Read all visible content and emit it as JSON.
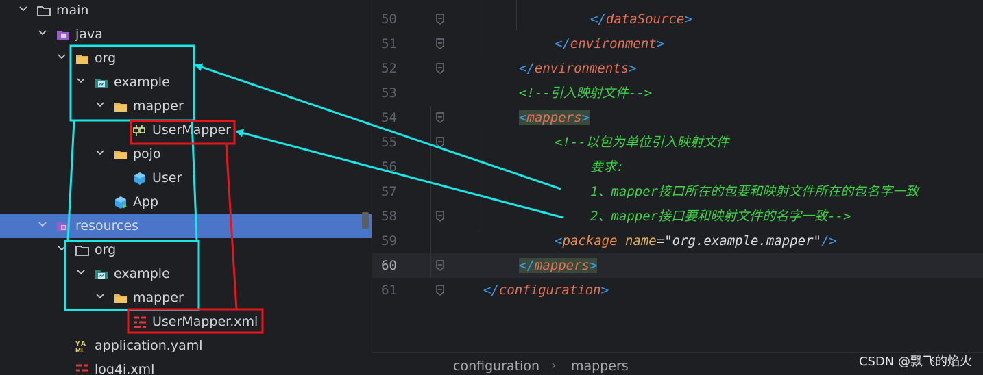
{
  "tree": [
    {
      "label": "main",
      "icon": "folder-icon",
      "chev": "down",
      "indent": 0
    },
    {
      "label": "java",
      "icon": "java-source-folder-icon",
      "chev": "down",
      "indent": 1
    },
    {
      "label": "org",
      "icon": "package-folder-icon",
      "chev": "down",
      "indent": 2
    },
    {
      "label": "example",
      "icon": "package-icon",
      "chev": "down",
      "indent": 3
    },
    {
      "label": "mapper",
      "icon": "package-folder-icon",
      "chev": "down",
      "indent": 4
    },
    {
      "label": "UserMapper",
      "icon": "interface-icon",
      "chev": "none",
      "indent": 5
    },
    {
      "label": "pojo",
      "icon": "package-folder-icon",
      "chev": "down",
      "indent": 4
    },
    {
      "label": "User",
      "icon": "class-icon",
      "chev": "none",
      "indent": 5
    },
    {
      "label": "App",
      "icon": "app-class-icon",
      "chev": "none",
      "indent": 4
    },
    {
      "label": "resources",
      "icon": "resources-folder-icon",
      "chev": "down",
      "indent": 1,
      "selected": true
    },
    {
      "label": "org",
      "icon": "folder-icon",
      "chev": "down",
      "indent": 2
    },
    {
      "label": "example",
      "icon": "package-icon",
      "chev": "down",
      "indent": 3
    },
    {
      "label": "mapper",
      "icon": "package-folder-icon",
      "chev": "down",
      "indent": 4
    },
    {
      "label": "UserMapper.xml",
      "icon": "xml-file-icon",
      "chev": "none",
      "indent": 5
    },
    {
      "label": "application.yaml",
      "icon": "yaml-file-icon",
      "chev": "none",
      "indent": 2
    },
    {
      "label": "log4j.xml",
      "icon": "xml-file-icon",
      "chev": "none",
      "indent": 2
    }
  ],
  "editor": {
    "current_line": "60",
    "lines": [
      {
        "num": "50",
        "tokens": [
          {
            "t": "</",
            "c": "br"
          },
          {
            "t": "dataSource",
            "c": "tag"
          },
          {
            "t": ">",
            "c": "br"
          }
        ],
        "indent": 4
      },
      {
        "num": "51",
        "tokens": [
          {
            "t": "</",
            "c": "br"
          },
          {
            "t": "environment",
            "c": "tag"
          },
          {
            "t": ">",
            "c": "br"
          }
        ],
        "indent": 3
      },
      {
        "num": "52",
        "tokens": [
          {
            "t": "</",
            "c": "br"
          },
          {
            "t": "environments",
            "c": "tag"
          },
          {
            "t": ">",
            "c": "br"
          }
        ],
        "indent": 2
      },
      {
        "num": "53",
        "tokens": [
          {
            "t": "<!--引入映射文件-->",
            "c": "cm"
          }
        ],
        "indent": 2
      },
      {
        "num": "54",
        "tokens": [
          {
            "t": "<",
            "c": "br",
            "hl": true
          },
          {
            "t": "mappers",
            "c": "tag",
            "hl": true
          },
          {
            "t": ">",
            "c": "br",
            "hl": true
          }
        ],
        "indent": 2
      },
      {
        "num": "55",
        "tokens": [
          {
            "t": "<!--以包为单位引入映射文件",
            "c": "cm"
          }
        ],
        "indent": 3
      },
      {
        "num": "56",
        "tokens": [
          {
            "t": "要求:",
            "c": "cm"
          }
        ],
        "indent": 4
      },
      {
        "num": "57",
        "tokens": [
          {
            "t": "1、mapper接口所在的包要和映射文件所在的包名字一致",
            "c": "cm"
          }
        ],
        "indent": 4
      },
      {
        "num": "58",
        "tokens": [
          {
            "t": "2、mapper接口要和映射文件的名字一致-->",
            "c": "cm"
          }
        ],
        "indent": 4
      },
      {
        "num": "59",
        "tokens": [
          {
            "t": "<",
            "c": "br"
          },
          {
            "t": "package",
            "c": "tag2"
          },
          {
            "t": " ",
            "c": "val"
          },
          {
            "t": "name",
            "c": "attr"
          },
          {
            "t": "=",
            "c": "val"
          },
          {
            "t": "\"org.example.mapper\"",
            "c": "val"
          },
          {
            "t": "/>",
            "c": "br"
          }
        ],
        "indent": 3
      },
      {
        "num": "60",
        "tokens": [
          {
            "t": "</",
            "c": "br",
            "hl": true
          },
          {
            "t": "mappers",
            "c": "tag",
            "hl": true
          },
          {
            "t": ">",
            "c": "br",
            "hl": true
          }
        ],
        "indent": 2
      },
      {
        "num": "61",
        "tokens": [
          {
            "t": "</",
            "c": "br"
          },
          {
            "t": "configuration",
            "c": "tag"
          },
          {
            "t": ">",
            "c": "br"
          }
        ],
        "indent": 1
      }
    ]
  },
  "breadcrumb": {
    "item1": "configuration",
    "item2": "mappers"
  },
  "watermark": "CSDN @飘飞的焰火",
  "colors": {
    "cyan_box": "#19e6e6",
    "red_box": "#e8161c",
    "selection": "#4a75c8"
  }
}
